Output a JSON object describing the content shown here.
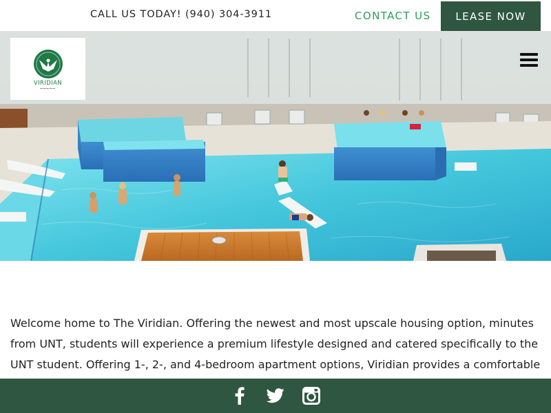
{
  "header": {
    "phone_text": "CALL US TODAY! (940) 304-3911",
    "contact_label": "CONTACT US",
    "lease_label": "LEASE NOW"
  },
  "logo": {
    "name": "VIRIDIAN"
  },
  "hero": {
    "image_icon": "pool-photo"
  },
  "menu": {
    "icon": "hamburger-menu-icon"
  },
  "intro": {
    "text": "Welcome home to The Viridian. Offering the newest and most upscale housing option, minutes from UNT, students will experience a premium lifestyle designed and catered specifically to the UNT student. Offering 1-, 2-, and 4-bedroom apartment options, Viridian provides a comfortable"
  },
  "footer": {
    "social_icons": [
      "facebook-icon",
      "twitter-icon",
      "instagram-icon"
    ]
  },
  "colors": {
    "brand_green": "#2f5641",
    "accent_green": "#2e9b5c",
    "pool_blue": "#4fd0e0"
  }
}
